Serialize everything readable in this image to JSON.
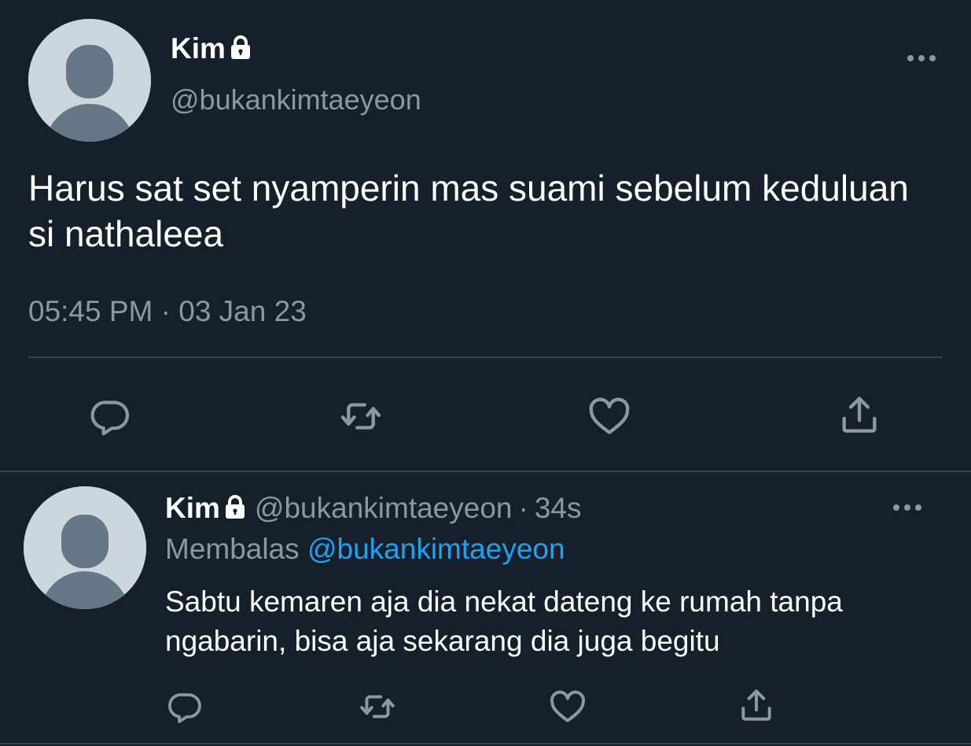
{
  "main_tweet": {
    "author_name": "Kim",
    "author_handle": "@bukankimtaeyeon",
    "text": "Harus sat set nyamperin mas suami sebelum keduluan si nathaleea",
    "timestamp": "05:45 PM · 03 Jan 23",
    "icons": {
      "lock": "lock-icon",
      "more": "more-icon",
      "reply": "reply-icon",
      "retweet": "retweet-icon",
      "like": "like-icon",
      "share": "share-icon"
    }
  },
  "reply_tweet": {
    "author_name": "Kim",
    "author_handle": "@bukankimtaeyeon",
    "separator": "·",
    "time_ago": "34s",
    "replying_label": "Membalas",
    "replying_to": "@bukankimtaeyeon",
    "text": "Sabtu kemaren aja dia nekat dateng ke rumah tanpa ngabarin, bisa aja sekarang dia juga begitu"
  },
  "colors": {
    "background": "#15202b",
    "primary_text": "#ffffff",
    "secondary_text": "#8899a6",
    "accent": "#1da1f2",
    "divider": "#38444d",
    "avatar_bg": "#ccd6dd",
    "avatar_figure": "#657786"
  }
}
